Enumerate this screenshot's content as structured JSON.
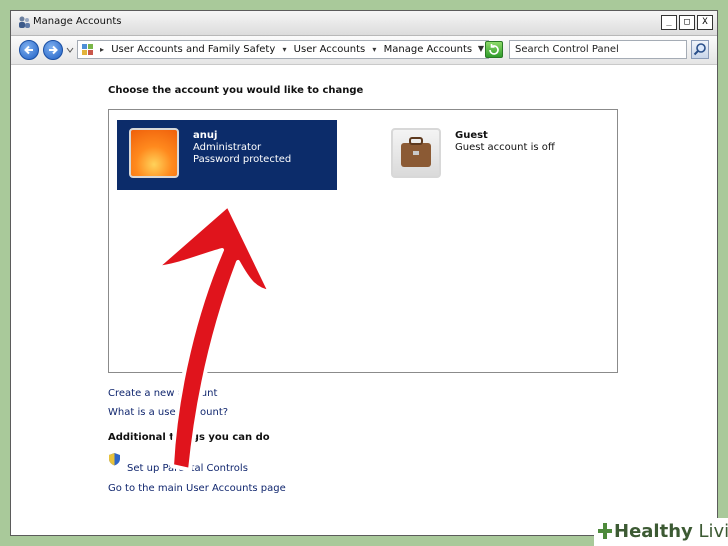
{
  "window": {
    "title": "Manage Accounts",
    "controls": [
      "_",
      "□",
      "X"
    ]
  },
  "address": {
    "crumbs": [
      "User Accounts and Family Safety",
      "User Accounts",
      "Manage Accounts"
    ]
  },
  "search": {
    "placeholder": "Search Control Panel"
  },
  "main": {
    "heading": "Choose the account you would like to change",
    "accounts": [
      {
        "name": "anuj",
        "line1": "Administrator",
        "line2": "Password protected",
        "selected": true
      },
      {
        "name": "Guest",
        "line1": "Guest account is off",
        "selected": false
      }
    ],
    "links": [
      "Create a new account",
      "What is a user account?"
    ],
    "additional_heading": "Additional things you can do",
    "additional_links": [
      "Set up Parental Controls",
      "Go to the main User Accounts page"
    ]
  },
  "watermark": {
    "bold": "Healthy",
    "light": " Living"
  },
  "colors": {
    "selected_bg": "#0c2c6a",
    "arrow": "#e0141c",
    "link": "#10266e"
  }
}
